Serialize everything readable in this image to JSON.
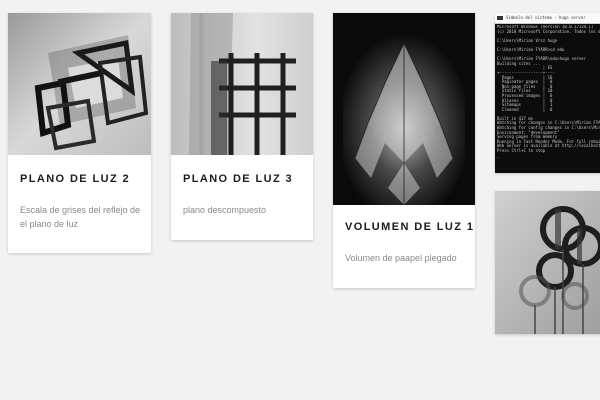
{
  "cards": [
    {
      "title": "PLANO DE LUZ 2",
      "description": "Escala de grises del reflejo de el plano de luz",
      "image": "grayscale-planes-photo"
    },
    {
      "title": "PLANO DE LUZ 3",
      "description": "plano descompuesto",
      "image": "grid-shadow-photo"
    },
    {
      "title": "VOLUMEN DE LUZ 1",
      "description": "Volumen de paapel plegado",
      "image": "folded-paper-light-photo"
    }
  ],
  "terminal": {
    "window_title": "Símbolo del sistema - hugo server",
    "lines": [
      "Microsoft Windows [Versión 10.0.17134.1]",
      "(c) 2018 Microsoft Corporation. Todos los derechos",
      "",
      "C:\\Users\\Mirian Vrsz hugo",
      "",
      "C:\\Users\\Mirian FYADR>cd edu",
      "",
      "C:\\Users\\Mirian FYADR\\edu>hugo server",
      "Building sites ...",
      "                   | ES",
      "+------------------+----",
      "  Pages            | 18",
      "  Paginator pages  |  0",
      "  Non-page files   |  0",
      "  Static files     | 10",
      "  Processed images |  0",
      "  Aliases          |  0",
      "  Sitemaps         |  1",
      "  Cleaned          |  0",
      "",
      "Built in 437 ms",
      "Watching for changes in C:\\Users\\Mirian FYADR\\",
      "Watching for config changes in C:\\Users\\Mirian",
      "Environment: \"development\"",
      "Serving pages from memory",
      "Running in Fast Render Mode. For full rebuilds",
      "Web Server is available at http://localhost:13",
      "Press Ctrl+C to stop",
      "_"
    ]
  },
  "partial_card": {
    "image": "circles-sculpture-photo"
  }
}
